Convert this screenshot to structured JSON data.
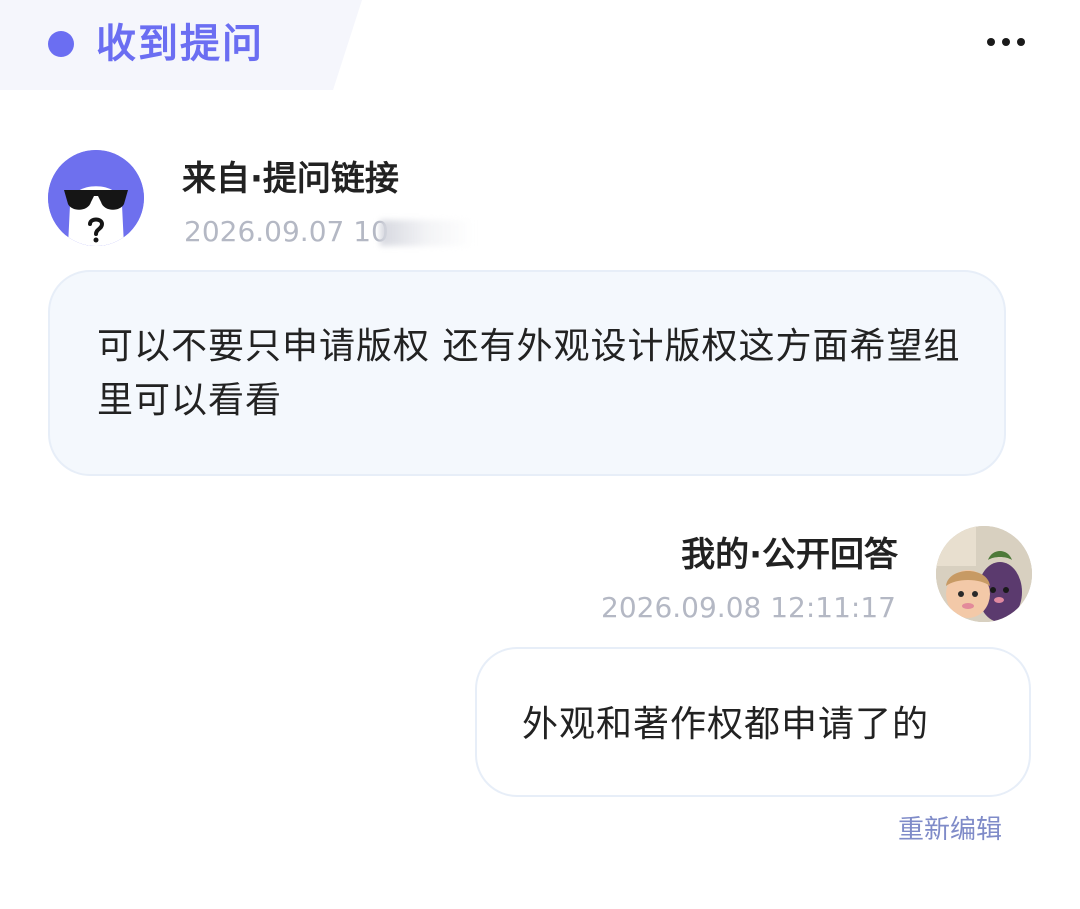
{
  "header": {
    "title": "收到提问",
    "more_icon": "more-horizontal-icon",
    "accent_color": "#6b6ef2"
  },
  "question": {
    "sender": "来自·提问链接",
    "timestamp": "2026.09.07 10",
    "text": "可以不要只申请版权 还有外观设计版权这方面希望组里可以看看",
    "avatar_icon": "sunglasses-ghost-icon"
  },
  "answer": {
    "label": "我的·公开回答",
    "timestamp": "2026.09.08 12:11:17",
    "text": "外观和著作权都申请了的",
    "avatar_icon": "eggplant-doll-avatar-icon",
    "reedit_label": "重新编辑"
  }
}
